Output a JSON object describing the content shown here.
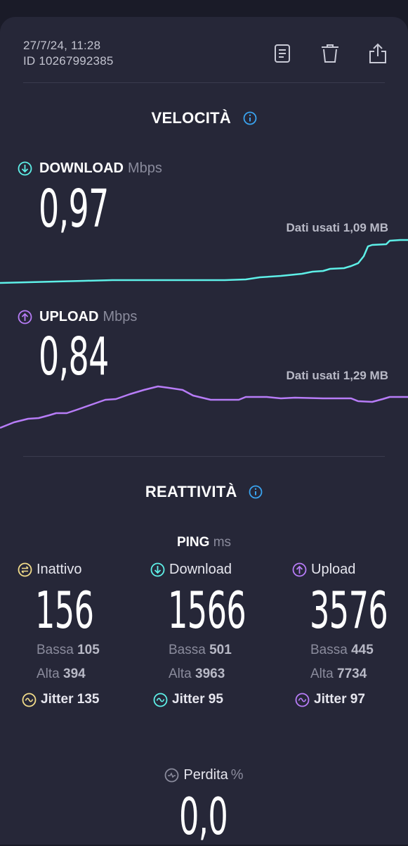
{
  "header": {
    "datetime": "27/7/24, 11:28",
    "result_id": "ID 10267992385"
  },
  "speed": {
    "title": "VELOCITÀ",
    "download": {
      "label": "DOWNLOAD",
      "unit": "Mbps",
      "value": "0,97",
      "data_used": "Dati usati 1,09 MB",
      "color": "#5ef0e8"
    },
    "upload": {
      "label": "UPLOAD",
      "unit": "Mbps",
      "value": "0,84",
      "data_used": "Dati usati 1,29 MB",
      "color": "#b77cf7"
    }
  },
  "responsiveness": {
    "title": "REATTIVITÀ",
    "ping_label": "PING",
    "ping_unit": "ms",
    "columns": [
      {
        "label": "Inattivo",
        "value": "156",
        "low_label": "Bassa",
        "low": "105",
        "high_label": "Alta",
        "high": "394",
        "jitter_label": "Jitter",
        "jitter": "135",
        "color": "#f2dc8a"
      },
      {
        "label": "Download",
        "value": "1566",
        "low_label": "Bassa",
        "low": "501",
        "high_label": "Alta",
        "high": "3963",
        "jitter_label": "Jitter",
        "jitter": "95",
        "color": "#5ef0e8"
      },
      {
        "label": "Upload",
        "value": "3576",
        "low_label": "Bassa",
        "low": "445",
        "high_label": "Alta",
        "high": "7734",
        "jitter_label": "Jitter",
        "jitter": "97",
        "color": "#b77cf7"
      }
    ]
  },
  "loss": {
    "label": "Perdita",
    "unit": "%",
    "value": "0,0"
  },
  "icons": {
    "report": "document-icon",
    "delete": "trash-icon",
    "share": "share-icon",
    "info": "info-icon"
  }
}
